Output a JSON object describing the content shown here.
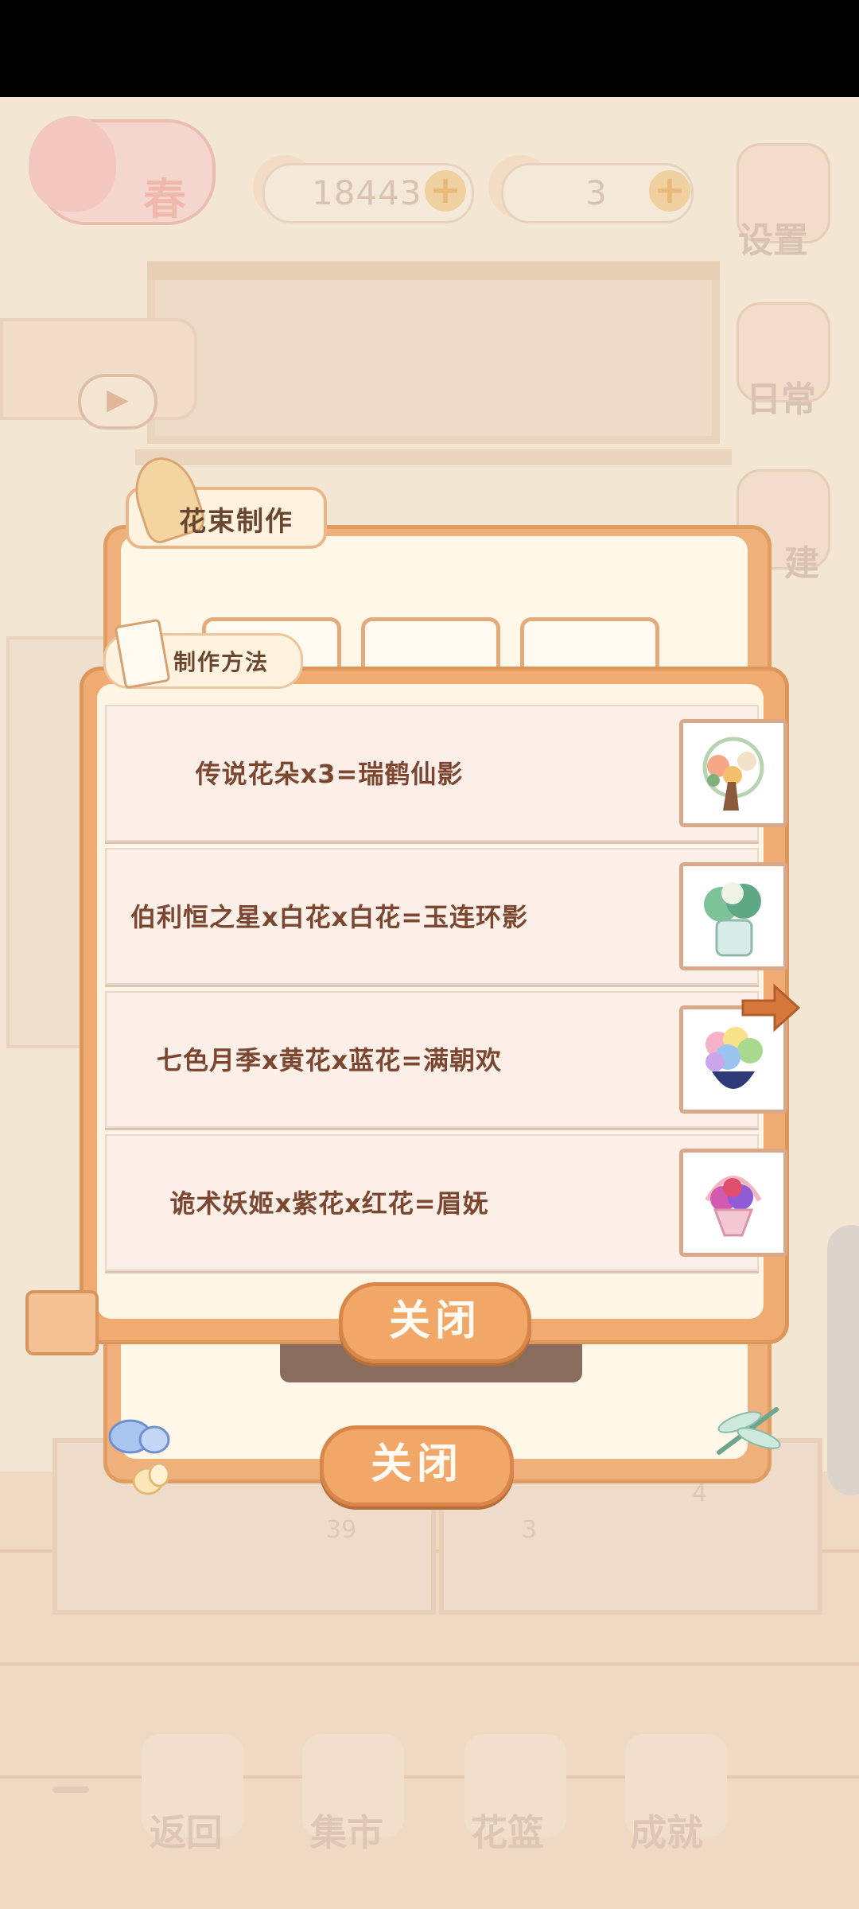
{
  "hud": {
    "season": "春",
    "fish_count": "18443",
    "cheese_count": "3",
    "plus": "+",
    "settings_label": "设置",
    "daily_label": "日常",
    "build_label": "建"
  },
  "bouquet_dialog": {
    "title": "花束制作",
    "close_label": "关闭"
  },
  "recipe_dialog": {
    "title": "制作方法",
    "close_label": "关闭",
    "recipes": [
      {
        "text": "传说花朵x3=瑞鹤仙影",
        "thumb_icon": "crane-bouquet-icon"
      },
      {
        "text": "伯利恒之星x白花x白花=玉连环影",
        "thumb_icon": "green-bouquet-icon"
      },
      {
        "text": "七色月季x黄花x蓝花=满朝欢",
        "thumb_icon": "rainbow-bouquet-icon"
      },
      {
        "text": "诡术妖姬x紫花x红花=眉妩",
        "thumb_icon": "flower-basket-icon"
      }
    ]
  },
  "counters": {
    "left_count": "39",
    "mid_count": "3",
    "right_count": "4"
  },
  "bottom_nav": [
    {
      "label": "返回"
    },
    {
      "label": "集市"
    },
    {
      "label": "花篮"
    },
    {
      "label": "成就"
    }
  ],
  "colors": {
    "accent_orange": "#f0a767",
    "panel_cream": "#fff5e5",
    "recipe_text": "#7b4730"
  }
}
